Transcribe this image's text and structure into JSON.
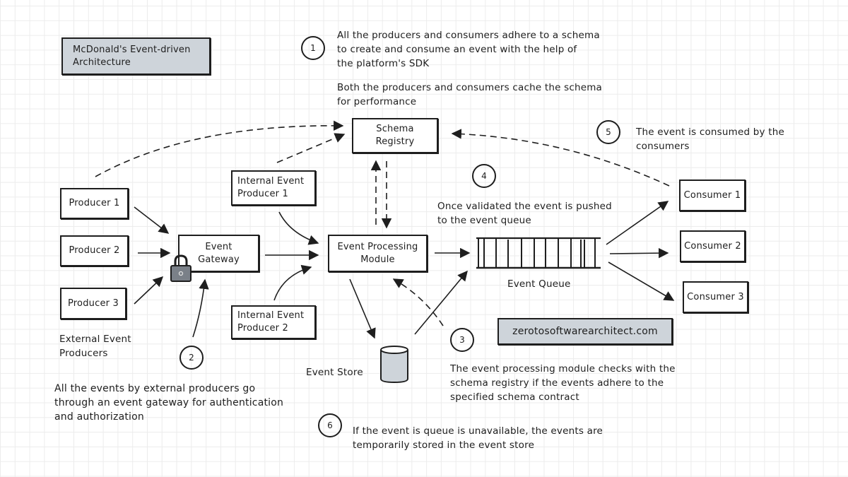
{
  "title": "McDonald's Event-driven\nArchitecture",
  "website": "zerotosoftwarearchitect.com",
  "colors": {
    "ink": "#1e1e1e",
    "gray_fill": "#ced4da",
    "grid": "#ececec"
  },
  "nodes": {
    "schema_registry": "Schema\nRegistry",
    "producer_1": "Producer 1",
    "producer_2": "Producer 2",
    "producer_3": "Producer 3",
    "external_producers_label": "External Event\nProducers",
    "event_gateway": "Event\nGateway",
    "internal_producer_1": "Internal Event\nProducer 1",
    "internal_producer_2": "Internal Event\nProducer 2",
    "event_processing_module": "Event Processing\nModule",
    "event_queue_label": "Event Queue",
    "event_store_label": "Event Store",
    "consumer_1": "Consumer 1",
    "consumer_2": "Consumer 2",
    "consumer_3": "Consumer 3"
  },
  "icons": {
    "gateway": "padlock-icon",
    "store": "database-cylinder-icon",
    "queue": "queue-icon"
  },
  "steps": [
    {
      "number": "1",
      "text": "All the producers and consumers adhere to a schema\nto create and consume an event with the help of\nthe platform's SDK"
    },
    {
      "number": "2",
      "text": "All the events by external producers go\nthrough an event gateway for authentication\nand authorization"
    },
    {
      "number": "3",
      "text": "The event processing module checks with the\nschema registry if the events adhere to the\nspecified schema contract"
    },
    {
      "number": "4",
      "text": "Once validated the event is pushed\nto the event queue"
    },
    {
      "number": "5",
      "text": "The event is consumed by the\nconsumers"
    },
    {
      "number": "6",
      "text": "If the event is queue is unavailable, the events are\ntemporarily stored in the event store"
    }
  ],
  "step1_note": "Both the producers and consumers cache the schema\nfor performance"
}
